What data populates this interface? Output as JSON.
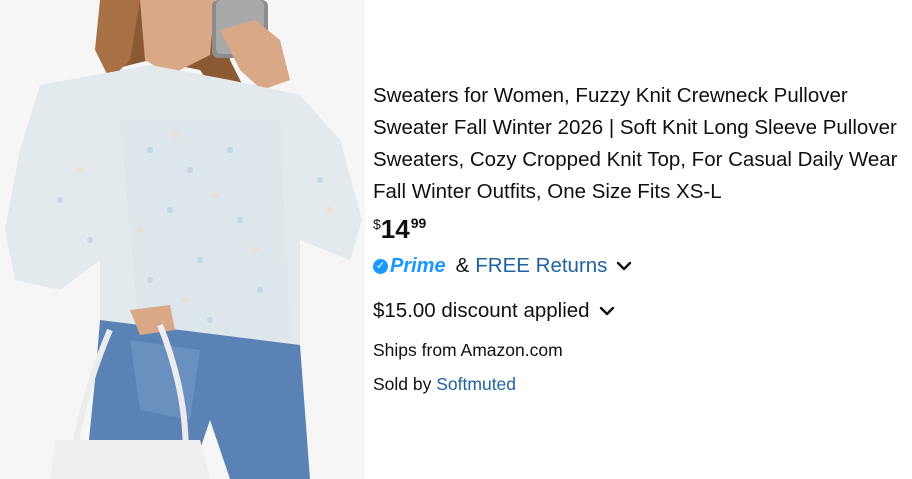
{
  "product": {
    "image_alt": "woman wearing fuzzy knit sweater",
    "title": "Sweaters for Women, Fuzzy Knit Crewneck Pullover Sweater Fall Winter 2026 | Soft Knit Long Sleeve Pullover Sweaters, Cozy Cropped Knit Top, For Casual Daily Wear Fall Winter Outfits, One Size Fits XS-L",
    "price": {
      "currency": "$",
      "whole": "14",
      "fraction": "99"
    },
    "prime": {
      "label": "Prime",
      "check_icon": "check-icon",
      "color": "#1a98ff",
      "ampersand": "&",
      "returns_label": "FREE Returns"
    },
    "discount": {
      "label": "$15.00 discount applied"
    },
    "ships_from": {
      "label": "Ships from Amazon.com"
    },
    "sold_by": {
      "prefix": "Sold by",
      "seller": "Softmuted"
    }
  },
  "colors": {
    "link": "#2162a1",
    "text": "#0f1111",
    "prime": "#1a98ff"
  }
}
